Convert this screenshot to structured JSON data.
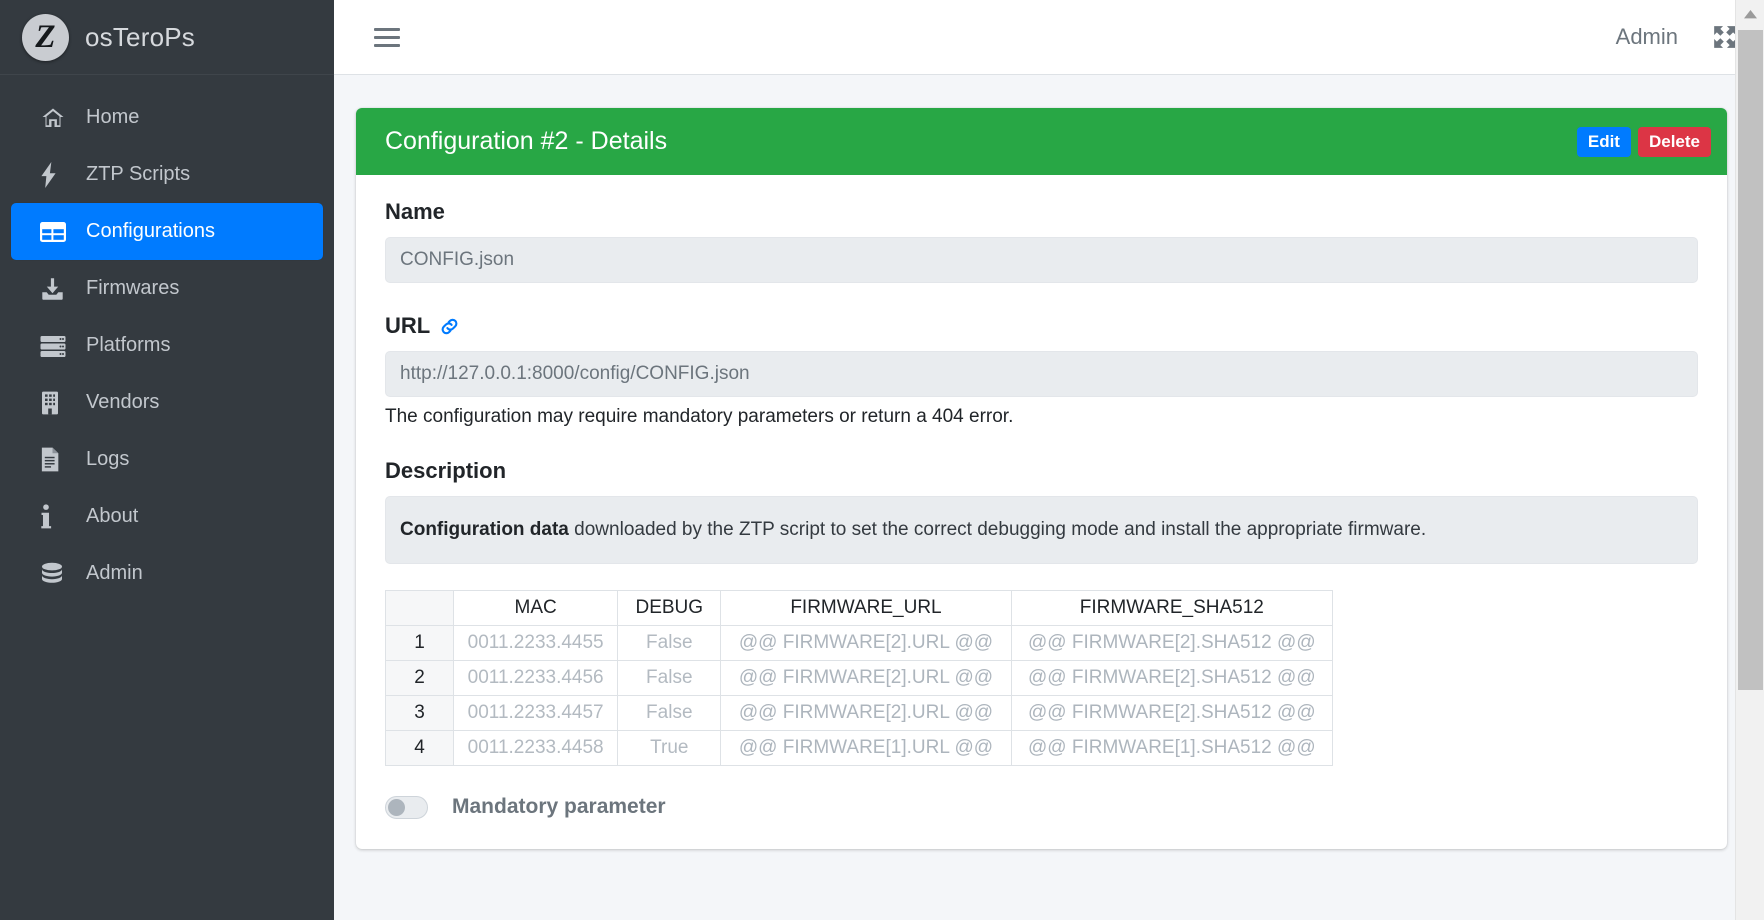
{
  "colors": {
    "sidebar_bg": "#343a40",
    "accent_blue": "#007bff",
    "header_green": "#28a745",
    "danger_red": "#dc3545",
    "content_bg": "#f4f6f9"
  },
  "sidebar": {
    "brand": {
      "logo_letter": "Z",
      "title": "osTeroPs"
    },
    "items": [
      {
        "label": "Home",
        "icon": "home-icon",
        "active": false
      },
      {
        "label": "ZTP Scripts",
        "icon": "bolt-icon",
        "active": false
      },
      {
        "label": "Configurations",
        "icon": "table-icon",
        "active": true
      },
      {
        "label": "Firmwares",
        "icon": "download-icon",
        "active": false
      },
      {
        "label": "Platforms",
        "icon": "server-icon",
        "active": false
      },
      {
        "label": "Vendors",
        "icon": "building-icon",
        "active": false
      },
      {
        "label": "Logs",
        "icon": "file-lines-icon",
        "active": false
      },
      {
        "label": "About",
        "icon": "info-icon",
        "active": false
      },
      {
        "label": "Admin",
        "icon": "database-icon",
        "active": false
      }
    ]
  },
  "topbar": {
    "menu_icon": "hamburger-icon",
    "admin_label": "Admin",
    "fullscreen_icon": "expand-arrows-icon"
  },
  "card": {
    "title": "Configuration #2 - Details",
    "edit_label": "Edit",
    "delete_label": "Delete"
  },
  "form": {
    "name_label": "Name",
    "name_value": "CONFIG.json",
    "url_label": "URL",
    "url_icon": "link-icon",
    "url_value": "http://127.0.0.1:8000/config/CONFIG.json",
    "url_help": "The configuration may require mandatory parameters or return a 404 error.",
    "description_label": "Description",
    "description_strong": "Configuration data",
    "description_rest": " downloaded by the ZTP script to set the correct debugging mode and install the appropriate firmware."
  },
  "table": {
    "columns": [
      "",
      "MAC",
      "DEBUG",
      "FIRMWARE_URL",
      "FIRMWARE_SHA512"
    ],
    "rows": [
      {
        "num": "1",
        "mac": "0011.2233.4455",
        "debug": "False",
        "url": "@@ FIRMWARE[2].URL @@",
        "sha": "@@ FIRMWARE[2].SHA512 @@"
      },
      {
        "num": "2",
        "mac": "0011.2233.4456",
        "debug": "False",
        "url": "@@ FIRMWARE[2].URL @@",
        "sha": "@@ FIRMWARE[2].SHA512 @@"
      },
      {
        "num": "3",
        "mac": "0011.2233.4457",
        "debug": "False",
        "url": "@@ FIRMWARE[2].URL @@",
        "sha": "@@ FIRMWARE[2].SHA512 @@"
      },
      {
        "num": "4",
        "mac": "0011.2233.4458",
        "debug": "True",
        "url": "@@ FIRMWARE[1].URL @@",
        "sha": "@@ FIRMWARE[1].SHA512 @@"
      }
    ]
  },
  "toggle": {
    "label": "Mandatory parameter",
    "state": "off"
  }
}
